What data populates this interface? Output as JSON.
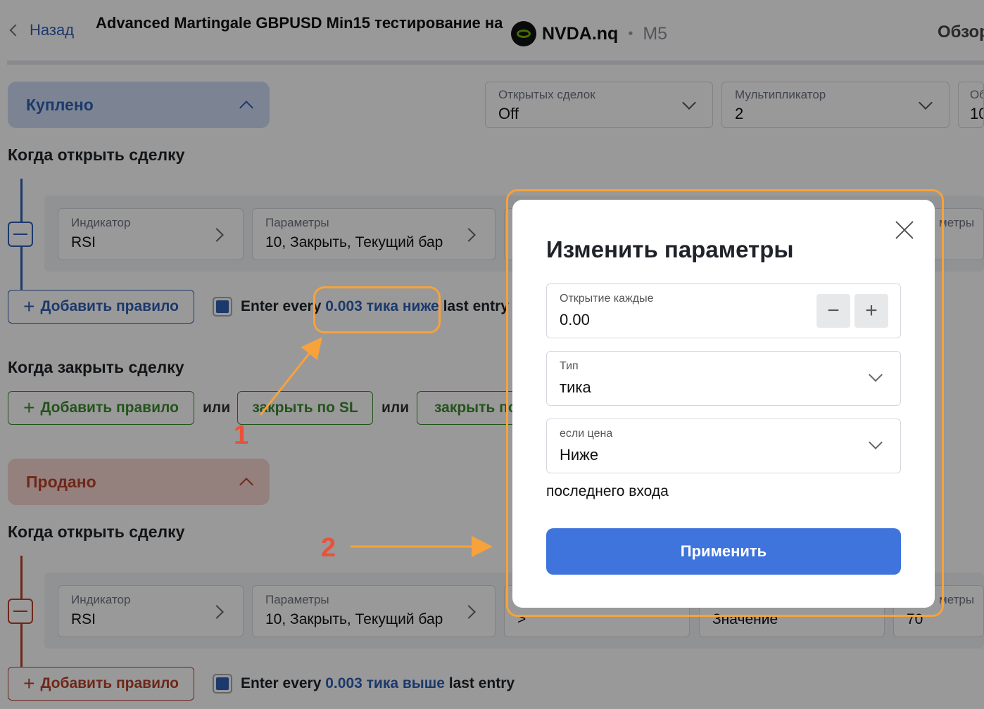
{
  "header": {
    "back_label": "Назад",
    "title": "Advanced Martingale GBPUSD Min15 тестирование на",
    "symbol": "NVDA.nq",
    "separator": "•",
    "timeframe": "M5",
    "overview_label": "Обзор"
  },
  "bought": {
    "section_label": "Куплено",
    "open_trades": {
      "label": "Открытых сделок",
      "value": "Off"
    },
    "multiplier": {
      "label": "Мультипликатор",
      "value": "2"
    },
    "third_partial": {
      "label": "Об",
      "value": "10"
    },
    "when_open": "Когда открыть сделку",
    "rule": {
      "indicator_label": "Индикатор",
      "indicator_value": "RSI",
      "params_label": "Параметры",
      "params_value": "10, Закрыть, Текущий бар",
      "right_partial_label": "метры"
    },
    "add_rule": "Добавить правило",
    "entry_prefix": "Enter every",
    "entry_link": "0.003 тика ниже",
    "entry_suffix": "last entry",
    "when_close": "Когда закрыть сделку",
    "or_label": "или",
    "close_sl": "закрыть по SL",
    "close_tp_partial": "закрыть по"
  },
  "sold": {
    "section_label": "Продано",
    "when_open": "Когда открыть сделку",
    "rule": {
      "indicator_label": "Индикатор",
      "indicator_value": "RSI",
      "params_label": "Параметры",
      "params_value": "10, Закрыть, Текущий бар",
      "compare_value": ">",
      "value_label": "Значение",
      "right_partial_label": "метры",
      "right_partial_value": "70"
    },
    "add_rule": "Добавить правило",
    "entry_prefix": "Enter every",
    "entry_link": "0.003 тика выше",
    "entry_suffix": "last entry"
  },
  "modal": {
    "title": "Изменить параметры",
    "open_every": {
      "label": "Открытие каждые",
      "value": "0.00"
    },
    "type": {
      "label": "Тип",
      "value": "тика"
    },
    "if_price": {
      "label": "если цена",
      "value": "Ниже"
    },
    "footer_text": "последнего входа",
    "apply_label": "Применить"
  },
  "annotations": {
    "marker1": "1",
    "marker2": "2"
  },
  "colors": {
    "accent_blue": "#3f74dc",
    "buy_blue": "#2f5fb3",
    "sell_red": "#b8412a",
    "close_green": "#3d8b2f",
    "highlight_orange": "#f7a23b",
    "annotation_red": "#e9523a"
  }
}
